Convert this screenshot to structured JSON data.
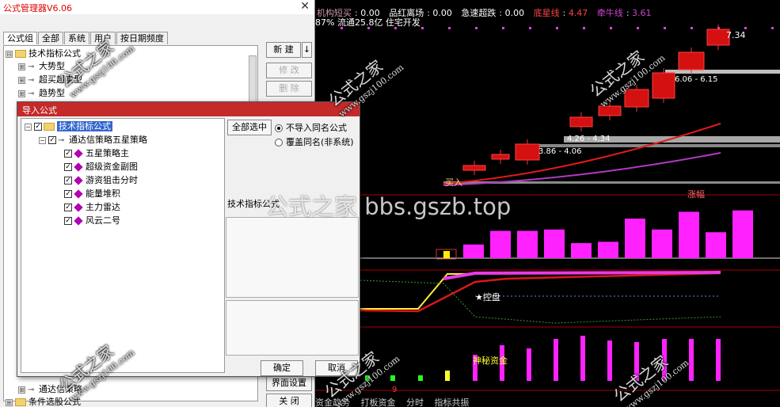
{
  "manager": {
    "title": "公式管理器V6.06",
    "close_glyph": "✕",
    "tabs": [
      "公式组",
      "全部",
      "系统",
      "用户",
      "按日期频度"
    ],
    "tree": [
      {
        "label": "技术指标公式",
        "exp": "⊟"
      },
      {
        "label": "大势型",
        "exp": "⊞"
      },
      {
        "label": "超买超卖型",
        "exp": "⊞"
      },
      {
        "label": "趋势型",
        "exp": "⊞"
      }
    ],
    "bottom_tree": [
      {
        "label": "通达信策略",
        "exp": "⊞"
      },
      {
        "label": "条件选股公式",
        "exp": "⊞"
      }
    ],
    "buttons": {
      "new": "新 建",
      "dropdown": "↓",
      "edit": "修 改",
      "delete": "删 除",
      "ui_settings": "界面设置",
      "close": "关 闭"
    }
  },
  "import": {
    "title": "导入公式",
    "root": "技术指标公式",
    "group": "通达信策略五星策略",
    "items": [
      "五星策略主",
      "超级资金副图",
      "游资狙击分时",
      "能量堆积",
      "主力雷达",
      "风云二号"
    ],
    "select_all": "全部选中",
    "radio_skip": "不导入同名公式",
    "radio_overwrite": "覆盖同名(非系统)",
    "section_label": "技术指标公式",
    "ok": "确定",
    "cancel": "取消"
  },
  "chart": {
    "info": [
      {
        "label": "机构短买",
        "value": "0.00"
      },
      {
        "label": "品红离场",
        "value": "0.00"
      },
      {
        "label": "急速超跌",
        "value": "0.00"
      },
      {
        "label": "底星线",
        "value": "4.47"
      },
      {
        "label": "牵牛线",
        "value": "3.61"
      }
    ],
    "info2": "87% 流通25.8亿 住宅开发",
    "price_labels": [
      "7.34",
      "6.06 - 6.15",
      "4.26 - 4.34",
      "3.86 - 4.06"
    ],
    "annotations": {
      "buy": "买入",
      "limit_up": "涨幅",
      "control": "★控盘",
      "secret_fund": "神秘资金",
      "number9": "9"
    },
    "bottom_tabs": [
      "资金趋势",
      "打板资金",
      "分时",
      "指标共振"
    ]
  },
  "watermarks": {
    "brand": "公式之家",
    "url": "www.gszj100.com",
    "big": "公式之家 bbs.gszb.top"
  },
  "chart_data": {
    "type": "bar",
    "series": [
      {
        "name": "",
        "values": [
          0.5,
          1.0,
          1.0,
          1.05,
          0.55,
          0.6,
          1.45,
          1.05,
          1.7,
          0.95,
          1.75
        ]
      }
    ]
  }
}
